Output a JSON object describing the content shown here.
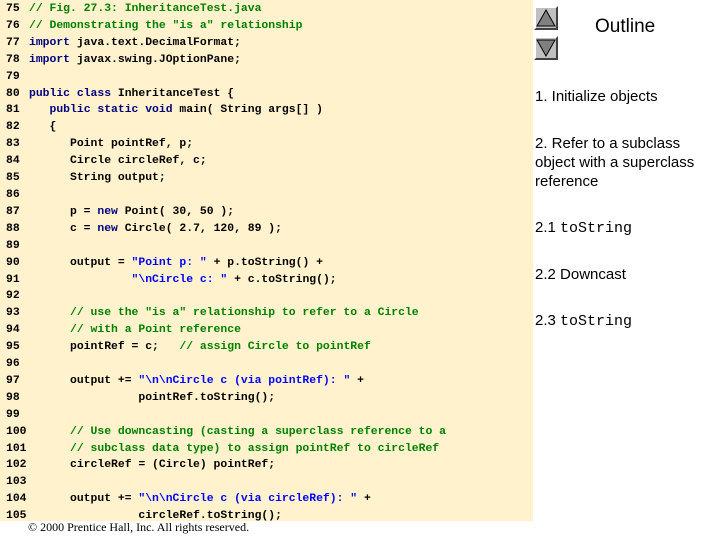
{
  "code_lines": [
    {
      "num": "75",
      "parts": [
        {
          "t": "// Fig. 27.3: InheritanceTest.java",
          "c": "c"
        }
      ]
    },
    {
      "num": "76",
      "parts": [
        {
          "t": "// Demonstrating the \"is a\" relationship",
          "c": "c"
        }
      ]
    },
    {
      "num": "77",
      "parts": [
        {
          "t": "import",
          "c": "k"
        },
        {
          "t": " java.text.DecimalFormat;",
          "c": ""
        }
      ]
    },
    {
      "num": "78",
      "parts": [
        {
          "t": "import",
          "c": "k"
        },
        {
          "t": " javax.swing.JOptionPane;",
          "c": ""
        }
      ]
    },
    {
      "num": "79",
      "parts": []
    },
    {
      "num": "80",
      "parts": [
        {
          "t": "public class",
          "c": "k"
        },
        {
          "t": " InheritanceTest {",
          "c": ""
        }
      ]
    },
    {
      "num": "81",
      "parts": [
        {
          "t": "   ",
          "c": ""
        },
        {
          "t": "public static void",
          "c": "k"
        },
        {
          "t": " main( String args[] )",
          "c": ""
        }
      ]
    },
    {
      "num": "82",
      "parts": [
        {
          "t": "   {",
          "c": ""
        }
      ]
    },
    {
      "num": "83",
      "parts": [
        {
          "t": "      Point pointRef, p;",
          "c": ""
        }
      ]
    },
    {
      "num": "84",
      "parts": [
        {
          "t": "      Circle circleRef, c;",
          "c": ""
        }
      ]
    },
    {
      "num": "85",
      "parts": [
        {
          "t": "      String output;",
          "c": ""
        }
      ]
    },
    {
      "num": "86",
      "parts": []
    },
    {
      "num": "87",
      "parts": [
        {
          "t": "      p = ",
          "c": ""
        },
        {
          "t": "new",
          "c": "k"
        },
        {
          "t": " Point( 30, 50 );",
          "c": ""
        }
      ]
    },
    {
      "num": "88",
      "parts": [
        {
          "t": "      c = ",
          "c": ""
        },
        {
          "t": "new",
          "c": "k"
        },
        {
          "t": " Circle( 2.7, 120, 89 );",
          "c": ""
        }
      ]
    },
    {
      "num": "89",
      "parts": []
    },
    {
      "num": "90",
      "parts": [
        {
          "t": "      output = ",
          "c": ""
        },
        {
          "t": "\"Point p: \"",
          "c": "s"
        },
        {
          "t": " + p.toString() +",
          "c": ""
        }
      ]
    },
    {
      "num": "91",
      "parts": [
        {
          "t": "               ",
          "c": ""
        },
        {
          "t": "\"\\nCircle c: \"",
          "c": "s"
        },
        {
          "t": " + c.toString();",
          "c": ""
        }
      ]
    },
    {
      "num": "92",
      "parts": []
    },
    {
      "num": "93",
      "parts": [
        {
          "t": "      // use the \"is a\" relationship to refer to a Circle",
          "c": "c"
        }
      ]
    },
    {
      "num": "94",
      "parts": [
        {
          "t": "      // with a Point reference",
          "c": "c"
        }
      ]
    },
    {
      "num": "95",
      "parts": [
        {
          "t": "      pointRef = c;   ",
          "c": ""
        },
        {
          "t": "// assign Circle to pointRef",
          "c": "c"
        }
      ]
    },
    {
      "num": "96",
      "parts": []
    },
    {
      "num": "97",
      "parts": [
        {
          "t": "      output += ",
          "c": ""
        },
        {
          "t": "\"\\n\\nCircle c (via pointRef): \"",
          "c": "s"
        },
        {
          "t": " +",
          "c": ""
        }
      ]
    },
    {
      "num": "98",
      "parts": [
        {
          "t": "                pointRef.toString();",
          "c": ""
        }
      ]
    },
    {
      "num": "99",
      "parts": []
    },
    {
      "num": "100",
      "parts": [
        {
          "t": "      // Use downcasting (casting a superclass reference to a",
          "c": "c"
        }
      ]
    },
    {
      "num": "101",
      "parts": [
        {
          "t": "      // subclass data type) to assign pointRef to circleRef",
          "c": "c"
        }
      ]
    },
    {
      "num": "102",
      "parts": [
        {
          "t": "      circleRef = (Circle) pointRef;",
          "c": ""
        }
      ]
    },
    {
      "num": "103",
      "parts": []
    },
    {
      "num": "104",
      "parts": [
        {
          "t": "      output += ",
          "c": ""
        },
        {
          "t": "\"\\n\\nCircle c (via circleRef): \"",
          "c": "s"
        },
        {
          "t": " +",
          "c": ""
        }
      ]
    },
    {
      "num": "105",
      "parts": [
        {
          "t": "                circleRef.toString();",
          "c": ""
        }
      ]
    }
  ],
  "copyright": "© 2000 Prentice Hall, Inc.  All rights reserved.",
  "nav": {
    "up_icon": "triangle-up-icon",
    "down_icon": "triangle-down-icon"
  },
  "outline": {
    "title": "Outline",
    "items": [
      {
        "text": "1. Initialize objects"
      },
      {
        "text": "2. Refer to a subclass object with a superclass reference"
      },
      {
        "prefix": "2.1 ",
        "mono": "toString"
      },
      {
        "text": "2.2 Downcast"
      },
      {
        "prefix": "2.3 ",
        "mono": "toString"
      }
    ]
  },
  "colors": {
    "code_background": "#fff2cc",
    "keyword": "#000080",
    "comment": "#008000",
    "string": "#0000ff",
    "button": "#c0c0c0"
  }
}
